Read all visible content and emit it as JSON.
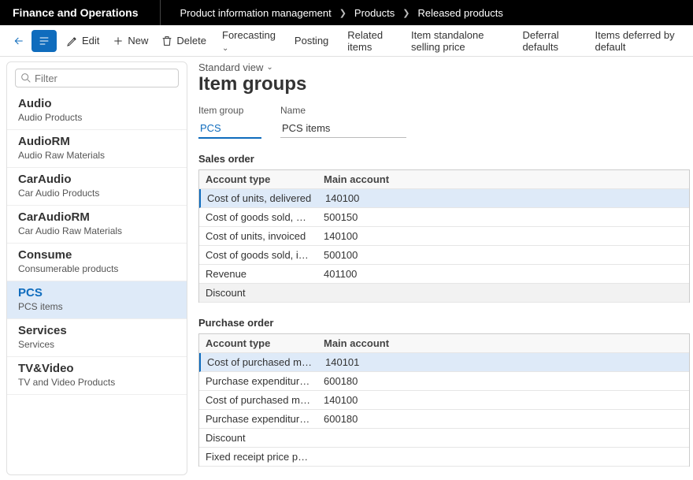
{
  "app_title": "Finance and Operations",
  "breadcrumb": [
    "Product information management",
    "Products",
    "Released products"
  ],
  "toolbar": {
    "edit": "Edit",
    "new": "New",
    "delete": "Delete",
    "forecasting": "Forecasting",
    "posting": "Posting",
    "related_items": "Related items",
    "standalone_price": "Item standalone selling price",
    "deferral_defaults": "Deferral defaults",
    "items_deferred": "Items deferred by default"
  },
  "filter_placeholder": "Filter",
  "sidebar": {
    "items": [
      {
        "title": "Audio",
        "sub": "Audio Products"
      },
      {
        "title": "AudioRM",
        "sub": "Audio Raw Materials"
      },
      {
        "title": "CarAudio",
        "sub": "Car Audio Products"
      },
      {
        "title": "CarAudioRM",
        "sub": "Car Audio Raw Materials"
      },
      {
        "title": "Consume",
        "sub": "Consumerable products"
      },
      {
        "title": "PCS",
        "sub": "PCS items"
      },
      {
        "title": "Services",
        "sub": "Services"
      },
      {
        "title": "TV&Video",
        "sub": "TV and Video Products"
      }
    ]
  },
  "content": {
    "std_view": "Standard view",
    "page_title": "Item groups",
    "field_item_group_label": "Item group",
    "field_item_group_value": "PCS",
    "field_name_label": "Name",
    "field_name_value": "PCS items",
    "sales_order_title": "Sales order",
    "purchase_order_title": "Purchase order",
    "col_account_type": "Account type",
    "col_main_account": "Main account",
    "sales_rows": [
      {
        "type": "Cost of units, delivered",
        "main": "140100"
      },
      {
        "type": "Cost of goods sold, deliv...",
        "main": "500150"
      },
      {
        "type": "Cost of units, invoiced",
        "main": "140100"
      },
      {
        "type": "Cost of goods sold, invoi...",
        "main": "500100"
      },
      {
        "type": "Revenue",
        "main": "401100"
      },
      {
        "type": "Discount",
        "main": ""
      }
    ],
    "purchase_rows": [
      {
        "type": "Cost of purchased materi...",
        "main": "140101"
      },
      {
        "type": "Purchase expenditure, un...",
        "main": "600180"
      },
      {
        "type": "Cost of purchased materi...",
        "main": "140100"
      },
      {
        "type": "Purchase expenditure for...",
        "main": "600180"
      },
      {
        "type": "Discount",
        "main": ""
      },
      {
        "type": "Fixed receipt price profit",
        "main": ""
      }
    ]
  }
}
